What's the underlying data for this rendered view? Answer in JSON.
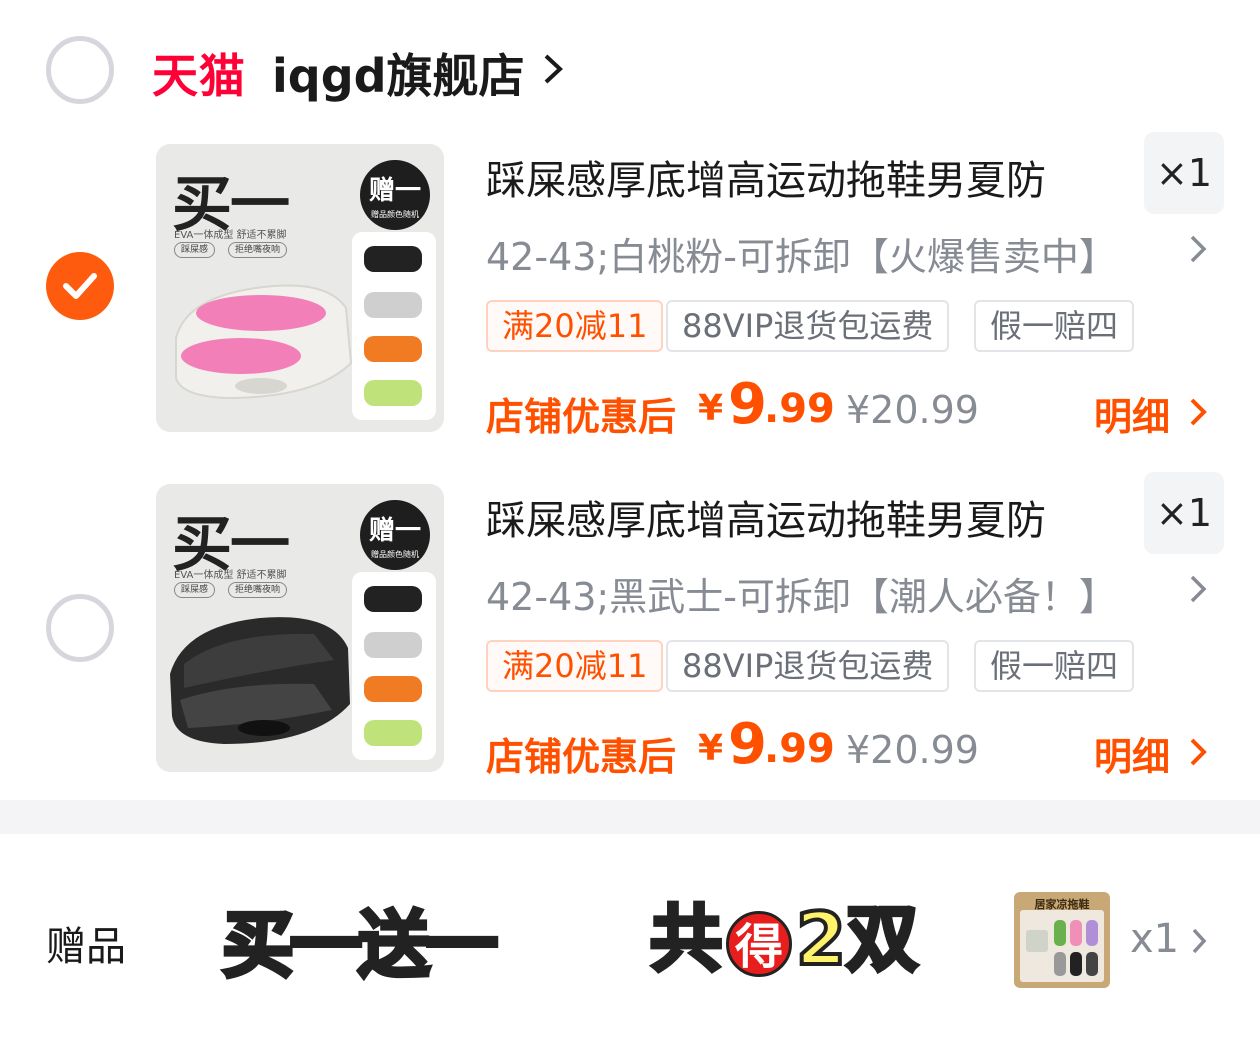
{
  "store": {
    "brand": "天猫",
    "name": "iqgd旗舰店"
  },
  "items": [
    {
      "checked": true,
      "thumb_big": "买一",
      "thumb_badge": "赠一",
      "thumb_badge_sub": "赠品颜色随机",
      "thumb_line1": "EVA一体成型 舒适不累脚",
      "thumb_pill1": "踩屎感",
      "thumb_pill2": "拒绝嘴夜响",
      "title": "踩屎感厚底增高运动拖鞋男夏防",
      "quantity": "×1",
      "sku": "42-43;白桃粉-可拆卸【火爆售卖中】",
      "tags": [
        "满20减11",
        "88VIP退货包运费",
        "假一赔四"
      ],
      "price_label": "店铺优惠后",
      "price_currency": "¥",
      "price_int": "9",
      "price_dec": ".99",
      "price_original": "¥20.99",
      "detail_label": "明细",
      "slipper_color": "#f27fb8"
    },
    {
      "checked": false,
      "thumb_big": "买一",
      "thumb_badge": "赠一",
      "thumb_badge_sub": "赠品颜色随机",
      "thumb_line1": "EVA一体成型 舒适不累脚",
      "thumb_pill1": "踩屎感",
      "thumb_pill2": "拒绝嘴夜响",
      "title": "踩屎感厚底增高运动拖鞋男夏防",
      "quantity": "×1",
      "sku": "42-43;黑武士-可拆卸【潮人必备！】",
      "tags": [
        "满20减11",
        "88VIP退货包运费",
        "假一赔四"
      ],
      "price_label": "店铺优惠后",
      "price_currency": "¥",
      "price_int": "9",
      "price_dec": ".99",
      "price_original": "¥20.99",
      "detail_label": "明细",
      "slipper_color": "#2a2a2a"
    }
  ],
  "gift": {
    "label": "赠品",
    "banner_left": "买一送一",
    "banner_right_pre": "共",
    "banner_right_circle": "得",
    "banner_right_post": "2双",
    "thumb_title": "居家凉拖鞋",
    "quantity": "x1"
  },
  "colors": {
    "accent": "#ff5000",
    "tmall_red": "#ff0036",
    "check_orange": "#ff5b0f",
    "muted": "#878b93"
  }
}
